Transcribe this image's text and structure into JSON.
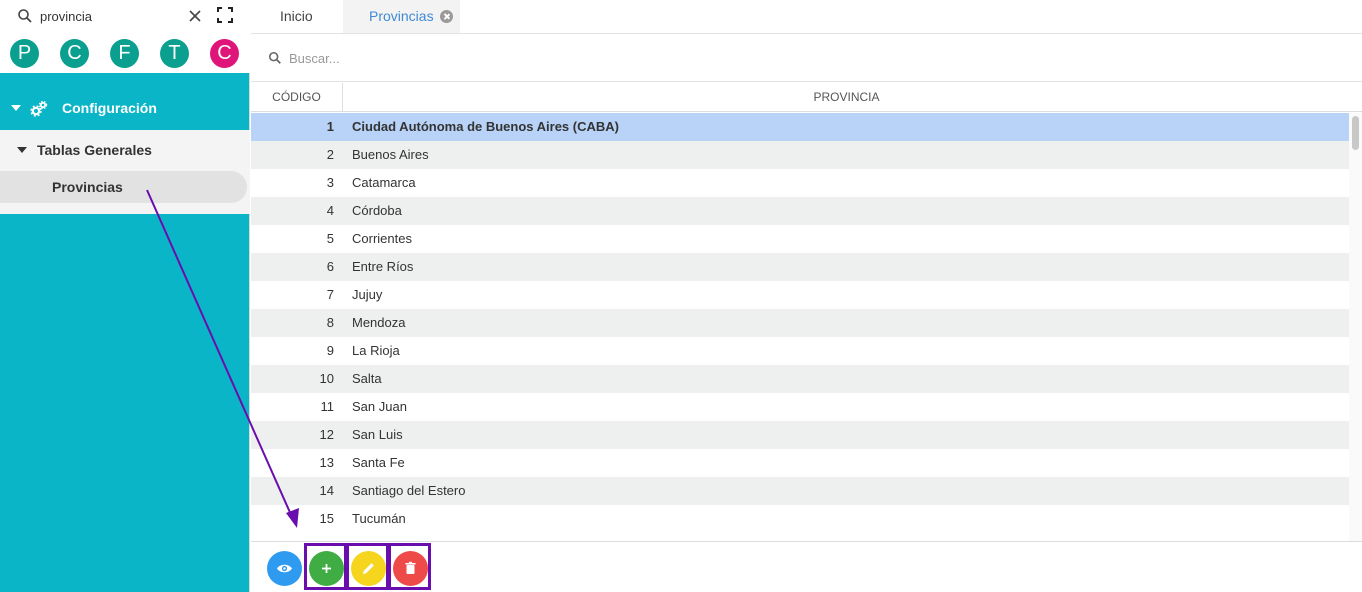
{
  "sidebar": {
    "search": {
      "value": "provincia"
    },
    "avatars": [
      {
        "letter": "P",
        "color": "#0a9f8f"
      },
      {
        "letter": "C",
        "color": "#0a9f8f"
      },
      {
        "letter": "F",
        "color": "#0a9f8f"
      },
      {
        "letter": "T",
        "color": "#0a9f8f"
      },
      {
        "letter": "C",
        "color": "#e0157a"
      }
    ],
    "menu": {
      "configuracion": "Configuración",
      "tablas_generales": "Tablas Generales",
      "provincias": "Provincias"
    },
    "accent_color": "#0bb5c8"
  },
  "tabs": [
    {
      "label": "Inicio",
      "active": false
    },
    {
      "label": "Provincias",
      "active": true
    }
  ],
  "grid": {
    "search_placeholder": "Buscar...",
    "columns": [
      "CÓDIGO",
      "PROVINCIA"
    ],
    "selected_row": 1,
    "rows": [
      {
        "codigo": "1",
        "provincia": "Ciudad Autónoma de Buenos Aires (CABA)"
      },
      {
        "codigo": "2",
        "provincia": "Buenos Aires"
      },
      {
        "codigo": "3",
        "provincia": "Catamarca"
      },
      {
        "codigo": "4",
        "provincia": "Córdoba"
      },
      {
        "codigo": "5",
        "provincia": "Corrientes"
      },
      {
        "codigo": "6",
        "provincia": "Entre Ríos"
      },
      {
        "codigo": "7",
        "provincia": "Jujuy"
      },
      {
        "codigo": "8",
        "provincia": "Mendoza"
      },
      {
        "codigo": "9",
        "provincia": "La Rioja"
      },
      {
        "codigo": "10",
        "provincia": "Salta"
      },
      {
        "codigo": "11",
        "provincia": "San Juan"
      },
      {
        "codigo": "12",
        "provincia": "San Luis"
      },
      {
        "codigo": "13",
        "provincia": "Santa Fe"
      },
      {
        "codigo": "14",
        "provincia": "Santiago del Estero"
      },
      {
        "codigo": "15",
        "provincia": "Tucumán"
      }
    ]
  },
  "toolbar": {
    "buttons": [
      {
        "action": "view",
        "icon": "eye-icon",
        "color": "#2e9bf0"
      },
      {
        "action": "add",
        "icon": "plus-icon",
        "color": "#3fac44"
      },
      {
        "action": "edit",
        "icon": "pencil-icon",
        "color": "#f5d51d"
      },
      {
        "action": "delete",
        "icon": "trash-icon",
        "color": "#ee4a4a"
      }
    ],
    "highlight_color": "#6a0dad"
  }
}
